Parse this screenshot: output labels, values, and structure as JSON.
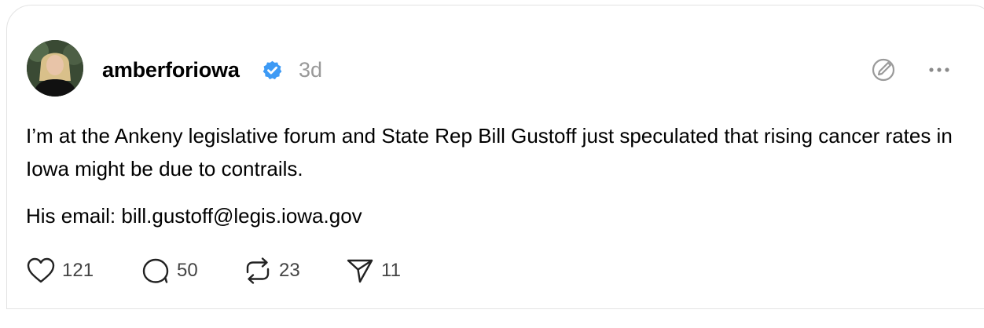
{
  "post": {
    "author": {
      "username": "amberforiowa",
      "verified": true,
      "avatar_icon": "profile-photo"
    },
    "timestamp": "3d",
    "paragraphs": [
      "I’m at the Ankeny legislative forum and State Rep Bill Gustoff just speculated that rising cancer rates in Iowa might be due to contrails.",
      "His email: bill.gustoff@legis.iowa.gov"
    ],
    "actions": {
      "likes": "121",
      "replies": "50",
      "reposts": "23",
      "shares": "11"
    }
  },
  "icons": {
    "verified": "verified-badge-icon",
    "edit": "edit-icon",
    "more": "more-icon",
    "like": "heart-icon",
    "reply": "comment-icon",
    "repost": "repost-icon",
    "share": "send-icon"
  },
  "colors": {
    "verified_badge": "#3d9af5",
    "muted_text": "#999999",
    "count_text": "#444444",
    "border": "#e3e3e3"
  }
}
